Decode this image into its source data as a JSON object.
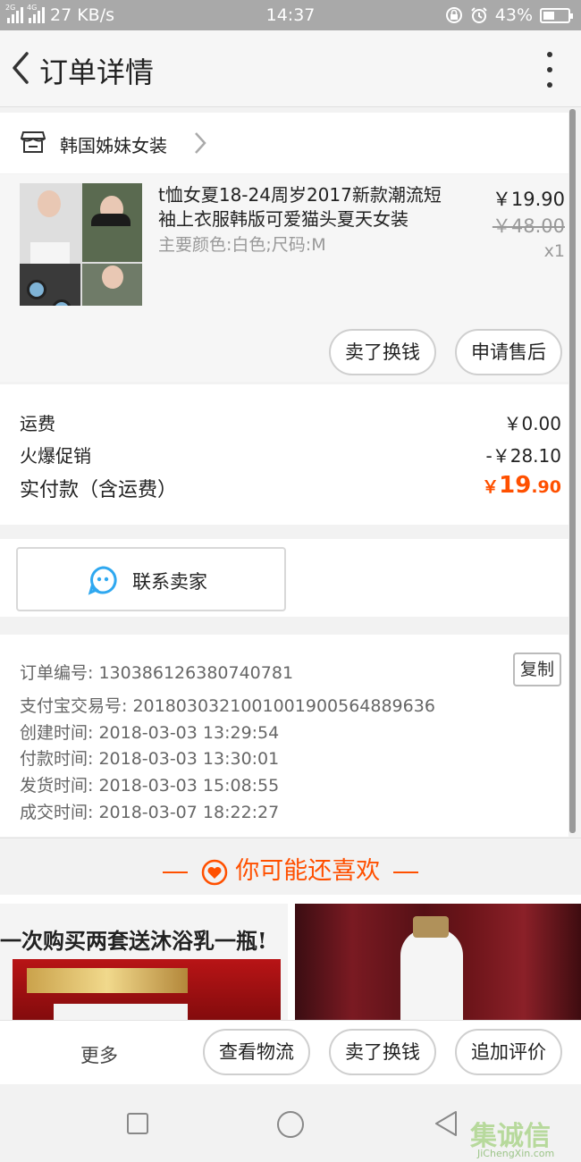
{
  "status_bar": {
    "network_speed": "27 KB/s",
    "time": "14:37",
    "battery": "43%",
    "sim1_label": "2G",
    "sim2_label": "4G"
  },
  "header": {
    "title": "订单详情"
  },
  "shop": {
    "name": "韩国姊妹女装"
  },
  "item": {
    "title": "t恤女夏18-24周岁2017新款潮流短袖上衣服韩版可爱猫头夏天女装",
    "attributes": "主要颜色:白色;尺码:M",
    "price": "￥19.90",
    "original_price": "￥48.00",
    "quantity": "x1",
    "actions": {
      "sell": "卖了换钱",
      "after_sale": "申请售后"
    }
  },
  "fees": {
    "shipping_label": "运费",
    "shipping_value": "￥0.00",
    "promo_label": "火爆促销",
    "promo_value": "-￥28.10",
    "total_label": "实付款（含运费）",
    "total_currency": "￥",
    "total_int": "19",
    "total_dec": ".90"
  },
  "contact": {
    "label": "联系卖家"
  },
  "order_info": {
    "order_no": "订单编号: 130386126380740781",
    "copy_label": "复制",
    "alipay_no": "支付宝交易号: 2018030321001001900564889636",
    "created": "创建时间: 2018-03-03 13:29:54",
    "paid": "付款时间: 2018-03-03 13:30:01",
    "shipped": "发货时间: 2018-03-03 15:08:55",
    "completed": "成交时间: 2018-03-07 18:22:27"
  },
  "recommend": {
    "title": "你可能还喜欢",
    "banner1_text": "一次购买两套送沐浴乳一瓶!"
  },
  "bottom_bar": {
    "more": "更多",
    "logistics": "查看物流",
    "sell": "卖了换钱",
    "review": "追加评价"
  },
  "watermark": {
    "cn": "集诚信",
    "en": "JiChengXin.com"
  },
  "colors": {
    "accent": "#ff5000",
    "contact_icon": "#2fa8f0",
    "status_bar": "#a9a9a9"
  }
}
